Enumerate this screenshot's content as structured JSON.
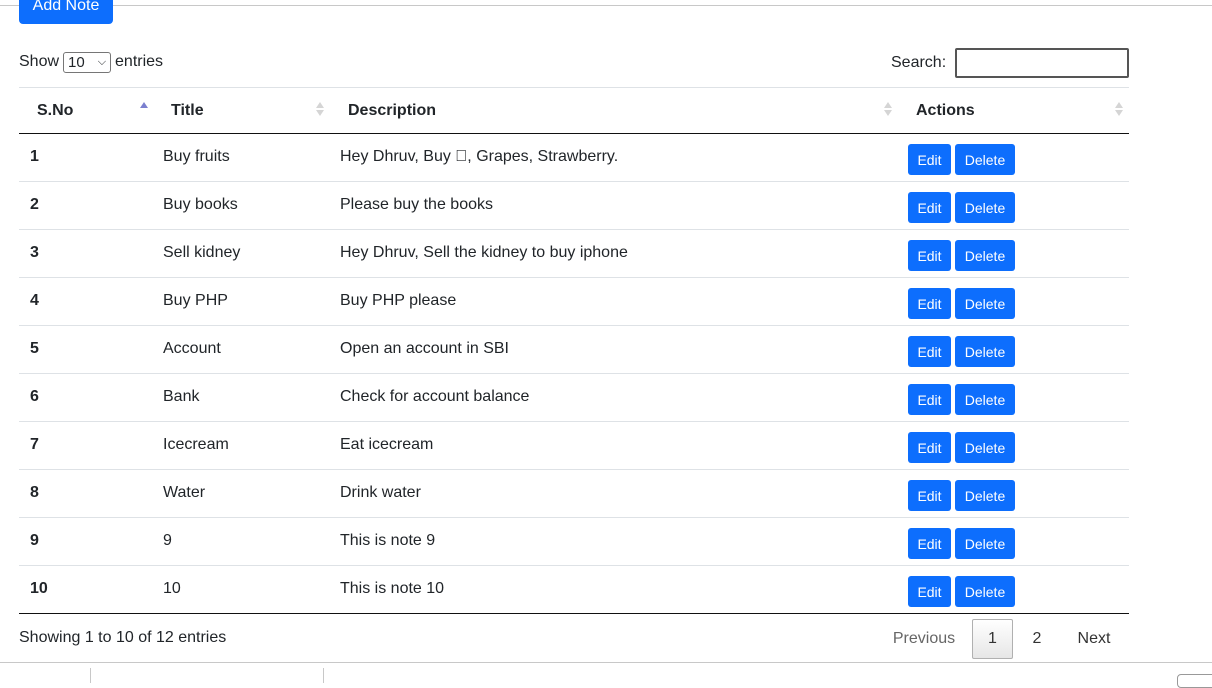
{
  "toolbar": {
    "add_note_label": "Add Note"
  },
  "length": {
    "prefix": "Show",
    "selected": "10",
    "suffix": "entries",
    "chevron_icon": "chevron-down-icon"
  },
  "search": {
    "label": "Search:",
    "value": "",
    "placeholder": ""
  },
  "table": {
    "columns": [
      "S.No",
      "Title",
      "Description",
      "Actions"
    ],
    "sorted_column": "S.No",
    "sort_direction": "ascending",
    "rows": [
      {
        "sno": "1",
        "title": "Buy fruits",
        "description": "Hey Dhruv, Buy , Grapes, Strawberry.",
        "edit": "Edit",
        "delete": "Delete"
      },
      {
        "sno": "2",
        "title": "Buy books",
        "description": "Please buy the books",
        "edit": "Edit",
        "delete": "Delete"
      },
      {
        "sno": "3",
        "title": "Sell kidney",
        "description": "Hey Dhruv, Sell the kidney to buy iphone",
        "edit": "Edit",
        "delete": "Delete"
      },
      {
        "sno": "4",
        "title": "Buy PHP",
        "description": "Buy PHP please",
        "edit": "Edit",
        "delete": "Delete"
      },
      {
        "sno": "5",
        "title": "Account",
        "description": "Open an account in SBI",
        "edit": "Edit",
        "delete": "Delete"
      },
      {
        "sno": "6",
        "title": "Bank",
        "description": "Check for account balance",
        "edit": "Edit",
        "delete": "Delete"
      },
      {
        "sno": "7",
        "title": "Icecream",
        "description": "Eat icecream",
        "edit": "Edit",
        "delete": "Delete"
      },
      {
        "sno": "8",
        "title": "Water",
        "description": "Drink water",
        "edit": "Edit",
        "delete": "Delete"
      },
      {
        "sno": "9",
        "title": "9",
        "description": "This is note 9",
        "edit": "Edit",
        "delete": "Delete"
      },
      {
        "sno": "10",
        "title": "10",
        "description": "This is note 10",
        "edit": "Edit",
        "delete": "Delete"
      }
    ]
  },
  "footer": {
    "info": "Showing 1 to 10 of 12 entries",
    "pagination": {
      "previous": "Previous",
      "pages": [
        "1",
        "2"
      ],
      "current_page": "1",
      "next": "Next"
    }
  },
  "colors": {
    "primary": "#0d6efd",
    "sort_active": "#7b7fcf"
  }
}
